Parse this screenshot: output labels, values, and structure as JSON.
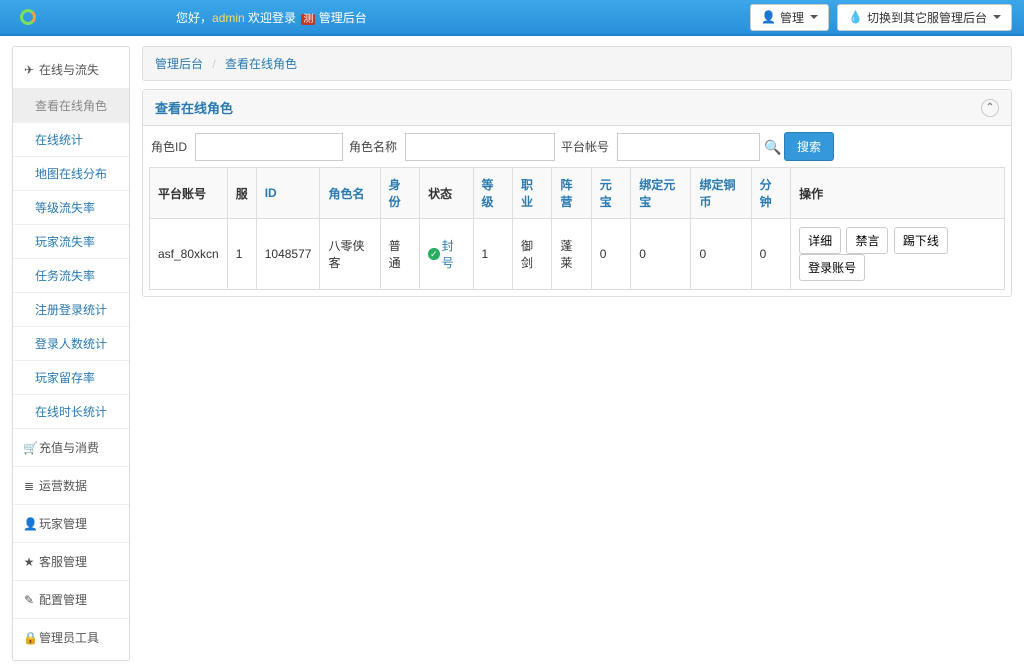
{
  "header": {
    "greeting_prefix": "您好，",
    "username": "admin",
    "greeting_mid": " 欢迎登录 ",
    "badge": "测",
    "greeting_suffix": " 管理后台",
    "manage_btn": "管理",
    "switch_btn": "切换到其它服管理后台"
  },
  "sidebar": {
    "groups": [
      {
        "icon": "✈",
        "label": "在线与流失",
        "expanded": true,
        "items": [
          "查看在线角色",
          "在线统计",
          "地图在线分布",
          "等级流失率",
          "玩家流失率",
          "任务流失率",
          "注册登录统计",
          "登录人数统计",
          "玩家留存率",
          "在线时长统计"
        ],
        "active_index": 0
      },
      {
        "icon": "🛒",
        "label": "充值与消费"
      },
      {
        "icon": "≣",
        "label": "运营数据"
      },
      {
        "icon": "👤",
        "label": "玩家管理"
      },
      {
        "icon": "★",
        "label": "客服管理"
      },
      {
        "icon": "✎",
        "label": "配置管理"
      },
      {
        "icon": "🔒",
        "label": "管理员工具"
      }
    ]
  },
  "breadcrumb": {
    "root": "管理后台",
    "current": "查看在线角色"
  },
  "panel": {
    "title": "查看在线角色"
  },
  "search": {
    "role_id_label": "角色ID",
    "role_name_label": "角色名称",
    "platform_label": "平台帐号",
    "btn": "搜索"
  },
  "table": {
    "headers": {
      "platform": "平台账号",
      "server": "服",
      "id": "ID",
      "role_name": "角色名",
      "identity": "身份",
      "status": "状态",
      "level": "等级",
      "job": "职业",
      "camp": "阵营",
      "gold": "元宝",
      "bound_gold": "绑定元宝",
      "bound_copper": "绑定铜币",
      "minutes": "分钟",
      "ops": "操作"
    },
    "row": {
      "platform": "asf_80xkcn",
      "server": "1",
      "id": "1048577",
      "role_name": "八零侠客",
      "identity": "普通",
      "status_text": "封号",
      "level": "1",
      "job": "御剑",
      "camp": "蓬莱",
      "gold": "0",
      "bound_gold": "0",
      "bound_copper": "0",
      "minutes": "0"
    },
    "ops": {
      "detail": "详细",
      "mute": "禁言",
      "kick": "踢下线",
      "loginacct": "登录账号"
    }
  }
}
